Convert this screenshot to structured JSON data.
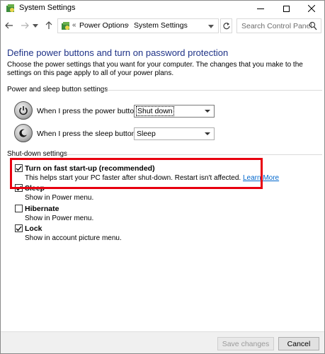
{
  "window": {
    "title": "System Settings"
  },
  "addressbar": {
    "breadcrumb_prefix": "«",
    "crumbs": [
      "Power Options",
      "System Settings"
    ],
    "separator": "›",
    "search_placeholder": "Search Control Panel"
  },
  "page": {
    "heading": "Define power buttons and turn on password protection",
    "description": "Choose the power settings that you want for your computer. The changes that you make to the settings on this page apply to all of your power plans."
  },
  "power_sleep": {
    "section_title": "Power and sleep button settings",
    "power_button": {
      "label": "When I press the power button:",
      "value": "Shut down"
    },
    "sleep_button": {
      "label": "When I press the sleep button:",
      "value": "Sleep"
    }
  },
  "shutdown": {
    "section_title": "Shut-down settings",
    "options": [
      {
        "title": "Turn on fast start-up (recommended)",
        "description": "This helps start your PC faster after shut-down. Restart isn't affected.",
        "link": "Learn More",
        "checked": true
      },
      {
        "title": "Sleep",
        "description": "Show in Power menu.",
        "checked": true
      },
      {
        "title": "Hibernate",
        "description": "Show in Power menu.",
        "checked": false
      },
      {
        "title": "Lock",
        "description": "Show in account picture menu.",
        "checked": true
      }
    ]
  },
  "footer": {
    "save_label": "Save changes",
    "cancel_label": "Cancel"
  },
  "colors": {
    "heading": "#1e3287",
    "link": "#0066cc",
    "highlight_border": "#e8000f"
  },
  "icons": [
    "app-icon",
    "minimize-icon",
    "maximize-icon",
    "close-icon",
    "back-arrow-icon",
    "forward-arrow-icon",
    "recent-locations-icon",
    "up-arrow-icon",
    "control-panel-icon",
    "refresh-icon",
    "search-icon",
    "power-button-icon",
    "sleep-button-icon",
    "checkmark-icon"
  ]
}
